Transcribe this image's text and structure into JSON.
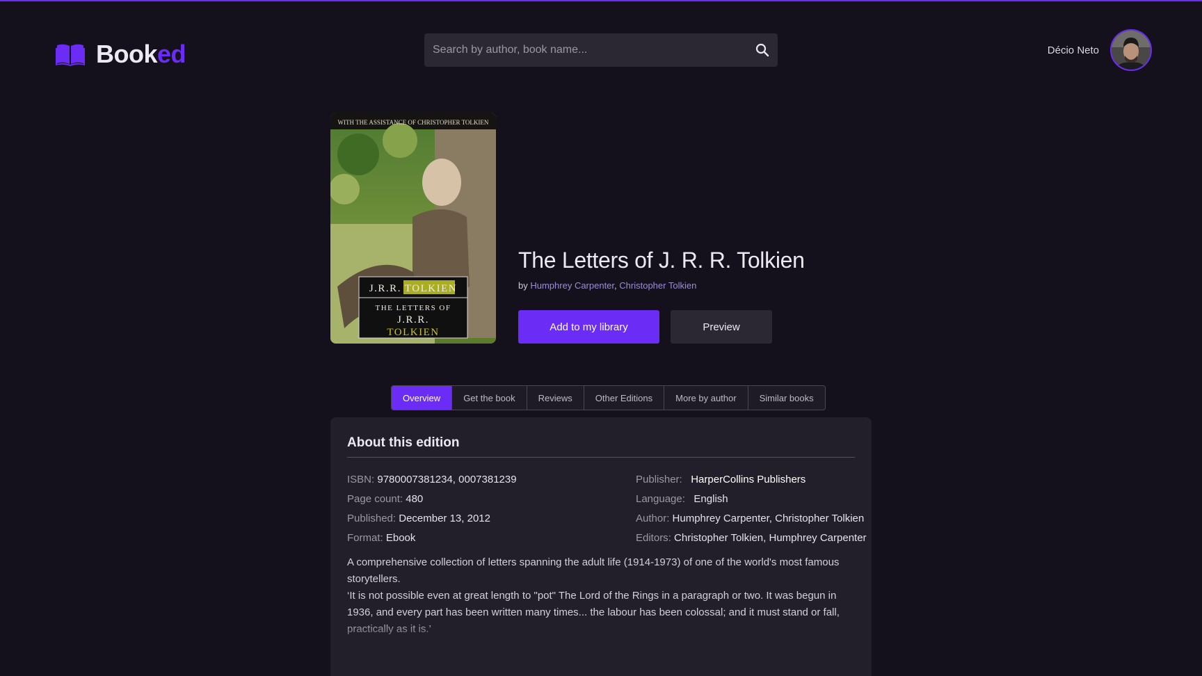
{
  "header": {
    "logo": {
      "part1": "Book",
      "part2": "ed"
    },
    "search": {
      "placeholder": "Search by author, book name...",
      "icon": "search-icon"
    },
    "user": {
      "name": "Décio Neto"
    }
  },
  "book": {
    "title": "The Letters of J. R. R. Tolkien",
    "by_prefix": "by",
    "authors": [
      "Humphrey Carpenter",
      "Christopher Tolkien"
    ],
    "author_separator": ", ",
    "cover": {
      "top_line": "WITH THE ASSISTANCE OF CHRISTOPHER TOLKIEN",
      "name_plate": "J.R.R. TOLKIEN",
      "title_line1": "THE LETTERS OF",
      "title_line2": "J.R.R.",
      "title_line3": "TOLKIEN"
    },
    "actions": {
      "add": "Add to my library",
      "preview": "Preview"
    }
  },
  "tabs": [
    {
      "label": "Overview",
      "active": true
    },
    {
      "label": "Get the book",
      "active": false
    },
    {
      "label": "Reviews",
      "active": false
    },
    {
      "label": "Other Editions",
      "active": false
    },
    {
      "label": "More by author",
      "active": false
    },
    {
      "label": "Similar books",
      "active": false
    }
  ],
  "about": {
    "title": "About this edition",
    "left": [
      {
        "label": "ISBN:",
        "value": "9780007381234, 0007381239"
      },
      {
        "label": "Page count:",
        "value": "480"
      },
      {
        "label": "Published:",
        "value": "December 13, 2012"
      },
      {
        "label": "Format:",
        "value": "Ebook"
      }
    ],
    "right": [
      {
        "label": "Publisher:",
        "value": "HarperCollins Publishers"
      },
      {
        "label": "Language:",
        "value": "English"
      },
      {
        "label": "Author:",
        "value": "Humphrey Carpenter,  Christopher Tolkien"
      },
      {
        "label": "Editors:",
        "value": "Christopher Tolkien, Humphrey Carpenter"
      }
    ],
    "description": [
      "A comprehensive collection of letters spanning the adult life (1914-1973) of one of the world's most famous storytellers.",
      "‘It is not possible even at great length to \"pot\" The Lord of the Rings in a paragraph or two. It was begun in 1936, and every part has been written many times... the labour has been colossal; and it must stand or fall, practically as it is.’"
    ]
  },
  "colors": {
    "accent": "#6b2cf5",
    "background": "#14111c",
    "surface": "#221f2a"
  }
}
